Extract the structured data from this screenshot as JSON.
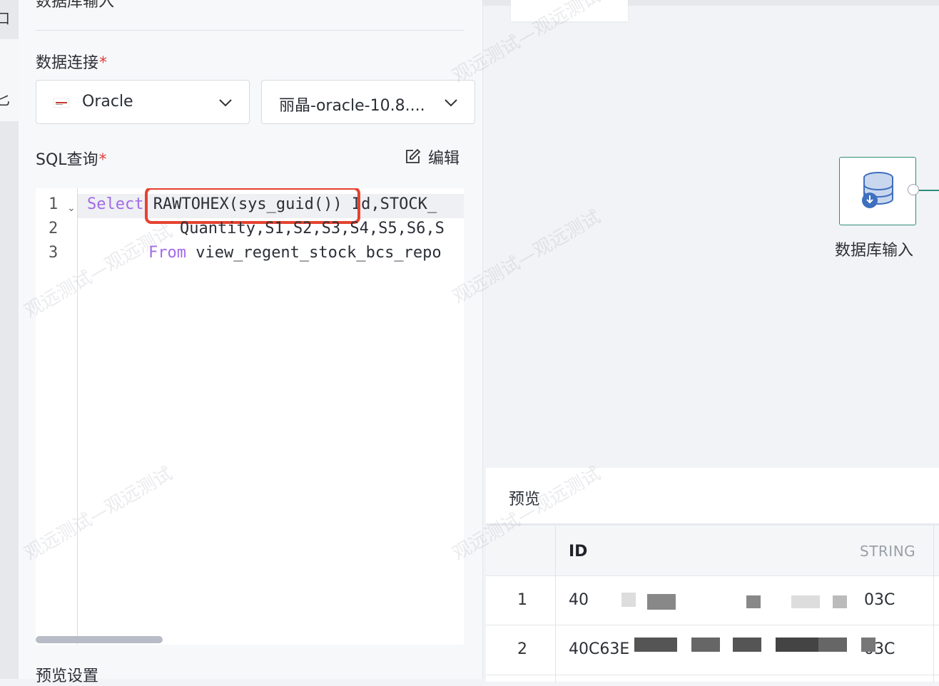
{
  "left_rail": {
    "item1": "口",
    "item2": "匕"
  },
  "panel": {
    "title": "数据库输入",
    "connection_label": "数据连接",
    "required_mark": "*",
    "db_type": "Oracle",
    "db_instance": "丽晶-oracle-10.8....",
    "sql_label": "SQL查询",
    "edit_label": "编辑",
    "preview_settings_label": "预览设置"
  },
  "editor": {
    "line_numbers": [
      "1",
      "2",
      "3"
    ],
    "line1_kw": "Select",
    "line1_highlight": "RAWTOHEX(sys_guid())",
    "line1_rest": " Id,STOCK_",
    "line2": "Quantity,S1,S2,S3,S4,S5,S6,S",
    "line3_kw": "From",
    "line3_rest": " view_regent_stock_bcs_repo"
  },
  "canvas": {
    "node_label": "数据库输入",
    "watermark": "观远测试—观远测试"
  },
  "preview": {
    "title": "预览",
    "columns": [
      {
        "name": "ID",
        "type": "STRING"
      }
    ],
    "rows": [
      {
        "num": "1",
        "id_prefix": "40",
        "id_suffix": "03C"
      },
      {
        "num": "2",
        "id_prefix": "40C63E",
        "id_suffix": "03C"
      }
    ]
  },
  "colors": {
    "accent_teal": "#2f8c7a",
    "highlight_red": "#e5422f",
    "keyword": "#a26ae8"
  }
}
